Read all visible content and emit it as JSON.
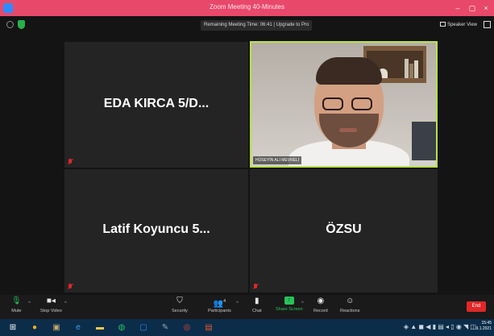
{
  "window": {
    "title": "Zoom Meeting 40-Minutes",
    "controls": [
      "–",
      "▢",
      "×"
    ]
  },
  "info_bar": {
    "timer_text": "Remaining Meeting Time: 06:41 | Upgrade to Pro",
    "view_button_label": "Speaker View"
  },
  "participants": [
    {
      "name": "EDA KIRCA 5/D...",
      "muted": true,
      "video": false
    },
    {
      "name": "HÜSEYİN ALİ MEVRELİ",
      "muted": false,
      "video": true
    },
    {
      "name": "Latif Koyuncu 5...",
      "muted": true,
      "video": false
    },
    {
      "name": "ÖZSU",
      "muted": true,
      "video": false
    }
  ],
  "toolbar": {
    "mute": "Mute",
    "stop_video": "Stop Video",
    "security": "Security",
    "participants": "Participants",
    "participants_count": "4",
    "chat": "Chat",
    "share_screen": "Share Screen",
    "record": "Record",
    "reactions": "Reactions",
    "end": "End"
  },
  "taskbar": {
    "time": "15:45",
    "date": "9.1.2021"
  },
  "colors": {
    "title_bar": "#e8486a",
    "active_speaker_border": "#b9e04a",
    "share_green": "#27c25a",
    "end_red": "#e02828",
    "taskbar": "#0c2d4a"
  }
}
